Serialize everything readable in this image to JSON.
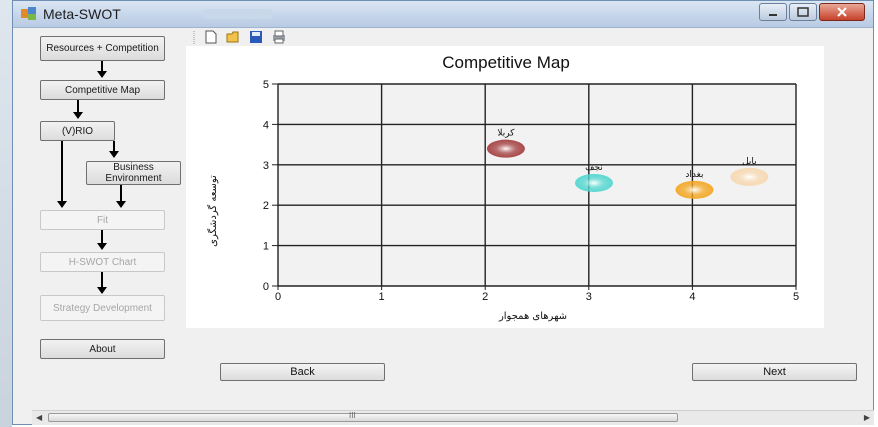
{
  "window": {
    "title": "Meta-SWOT"
  },
  "sidebar": {
    "resources": "Resources + Competition",
    "competitive_map": "Competitive Map",
    "vrio": "(V)RIO",
    "business_env": "Business Environment",
    "fit": "Fit",
    "hswot": "H-SWOT Chart",
    "strategy": "Strategy Development",
    "about": "About"
  },
  "buttons": {
    "back": "Back",
    "next": "Next"
  },
  "scrollbar": {
    "grip": "III"
  },
  "chart_data": {
    "type": "bubble",
    "title": "Competitive Map",
    "xlabel": "شهرهای همجوار",
    "ylabel": "توسعه گردشگری",
    "xlim": [
      0,
      5
    ],
    "ylim": [
      0,
      5
    ],
    "xticks": [
      0,
      1,
      2,
      3,
      4,
      5
    ],
    "yticks": [
      0,
      1,
      2,
      3,
      4,
      5
    ],
    "grid": true,
    "points": [
      {
        "label": "کربلا",
        "x": 2.2,
        "y": 3.4,
        "color": "#a23b3b"
      },
      {
        "label": "نجف",
        "x": 3.05,
        "y": 2.55,
        "color": "#4fd6cf"
      },
      {
        "label": "بغداد",
        "x": 4.02,
        "y": 2.38,
        "color": "#f3a51e"
      },
      {
        "label": "بابل",
        "x": 4.55,
        "y": 2.7,
        "color": "#f7d8b0"
      }
    ]
  }
}
